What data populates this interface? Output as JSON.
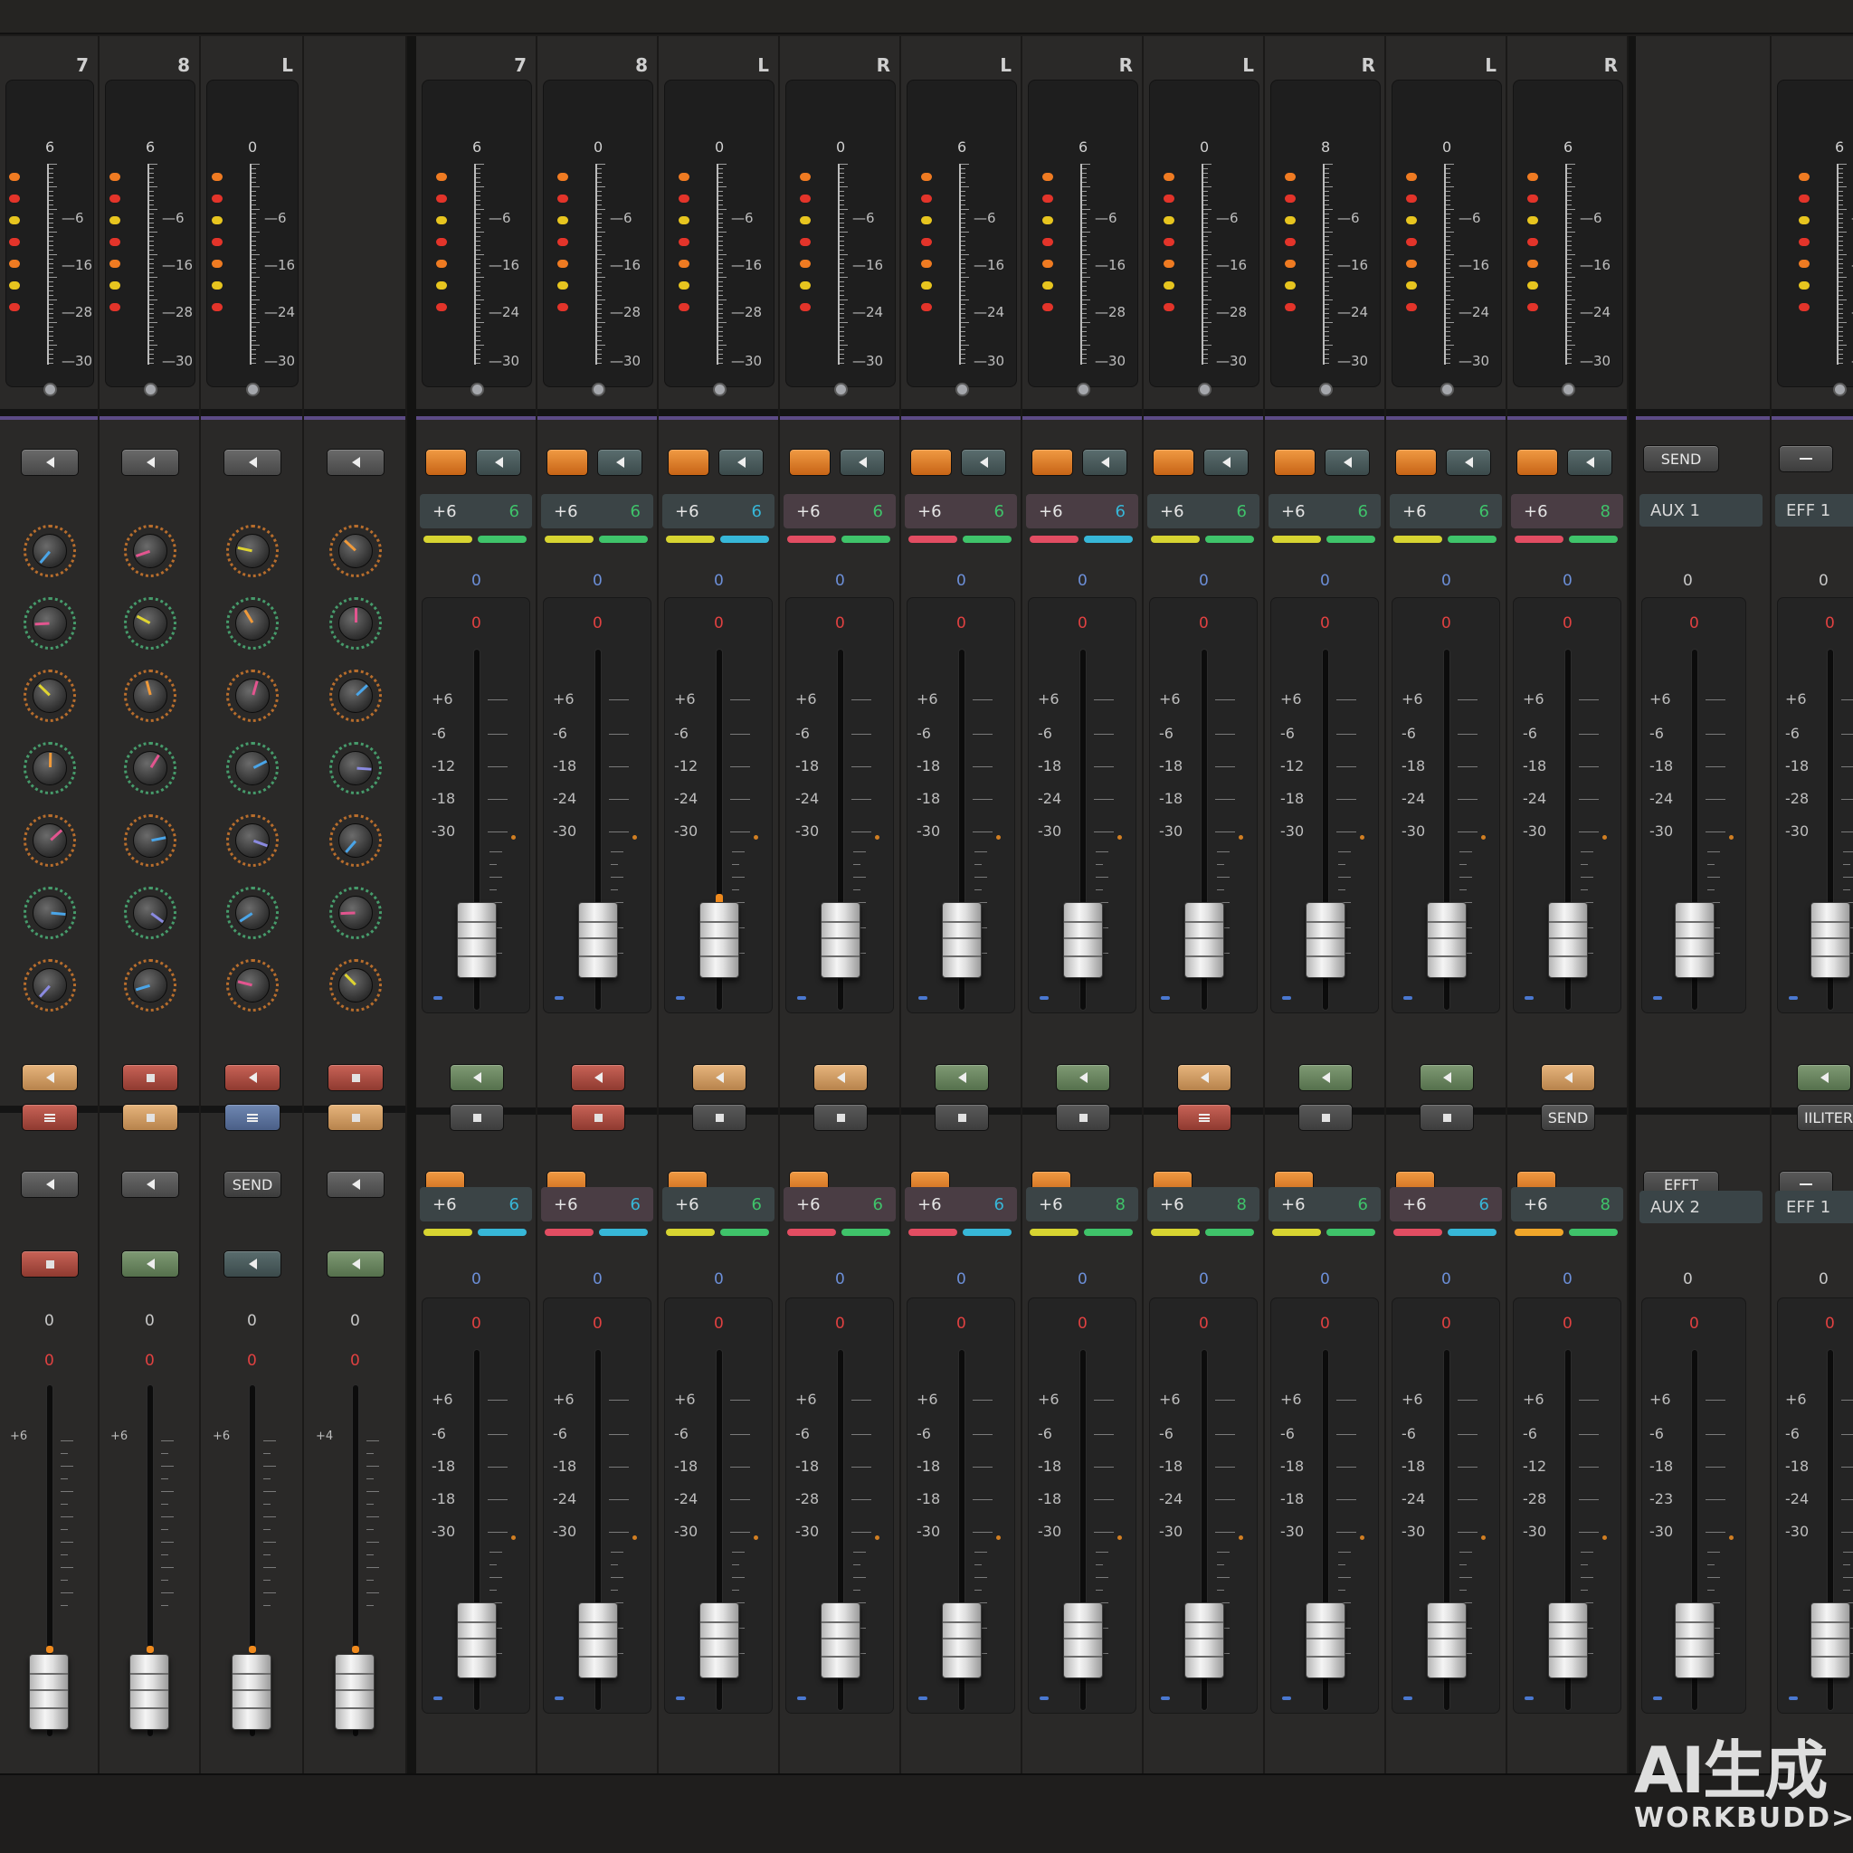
{
  "meter_scale_labels": [
    "6",
    "16",
    "28",
    "30"
  ],
  "left_strips": [
    {
      "name": "7",
      "top": "6",
      "scale": [
        "6",
        "16",
        "28",
        "30"
      ],
      "row1": {
        "color": "gray",
        "icon": "arrow"
      },
      "row_lower": [
        {
          "color": "tan",
          "icon": "arrow"
        },
        {
          "color": "red",
          "icon": "lines"
        }
      ],
      "row_b1": {
        "color": "gray",
        "icon": "arrow",
        "label": ""
      },
      "row_b2": {
        "color": "red",
        "icon": "sq"
      }
    },
    {
      "name": "8",
      "top": "6",
      "scale": [
        "6",
        "16",
        "28",
        "30"
      ],
      "row1": {
        "color": "gray",
        "icon": "arrow"
      },
      "row_lower": [
        {
          "color": "red",
          "icon": "sq"
        },
        {
          "color": "tan",
          "icon": "sq"
        }
      ],
      "row_b1": {
        "color": "gray",
        "icon": "arrow",
        "label": ""
      },
      "row_b2": {
        "color": "green",
        "icon": "arrow"
      }
    },
    {
      "name": "L",
      "top": "0",
      "scale": [
        "6",
        "16",
        "24",
        "30"
      ],
      "row1": {
        "color": "gray",
        "icon": "arrow"
      },
      "row_lower": [
        {
          "color": "red",
          "icon": "arrow"
        },
        {
          "color": "blue",
          "icon": "lines"
        }
      ],
      "row_b1": {
        "color": "dark",
        "icon": "none",
        "label": "SEND"
      },
      "row_b2": {
        "color": "teal",
        "icon": "arrow"
      }
    },
    {
      "name": "",
      "top": "",
      "scale": [],
      "row1": {
        "color": "gray",
        "icon": "arrow"
      },
      "row_lower": [
        {
          "color": "red",
          "icon": "sq"
        },
        {
          "color": "tan",
          "icon": "sq"
        }
      ],
      "row_b1": {
        "color": "gray",
        "icon": "arrow",
        "label": ""
      },
      "row_b2": {
        "color": "green",
        "icon": "arrow"
      }
    }
  ],
  "left_fader_labels": [
    "+6",
    "+6",
    "+6",
    "+4"
  ],
  "center_strips": [
    {
      "name": "7",
      "top": "6",
      "scale": [
        "6",
        "16",
        "24",
        "30"
      ],
      "pan": [
        "+6",
        "6"
      ],
      "bars": [
        "#d7d431",
        "#3fc36a"
      ],
      "fader_top": [
        "+6",
        "-6",
        "-12",
        "-18",
        "-30"
      ],
      "level": 0.03,
      "fill": "#3d7ad8",
      "btn_a": {
        "color": "green",
        "icon": "arrow",
        "label": ""
      },
      "btn_b": {
        "color": "dark",
        "icon": "sq",
        "label": ""
      },
      "pan2": [
        "+6",
        "6"
      ],
      "bars2": [
        "#d7d431",
        "#37b7d8"
      ],
      "fader_bot": [
        "+6",
        "-6",
        "-18",
        "-18",
        "-30"
      ],
      "level2": 0.03,
      "fill2": "#3d7ad8"
    },
    {
      "name": "8",
      "top": "0",
      "scale": [
        "6",
        "16",
        "28",
        "30"
      ],
      "pan": [
        "+6",
        "6"
      ],
      "bars": [
        "#d7d431",
        "#3fc36a"
      ],
      "fader_top": [
        "+6",
        "-6",
        "-18",
        "-24",
        "-30"
      ],
      "level": 0.15,
      "fill": "#f08a1d",
      "btn_a": {
        "color": "red",
        "icon": "arrow",
        "label": ""
      },
      "btn_b": {
        "color": "red",
        "icon": "sq",
        "label": ""
      },
      "pan2": [
        "+6",
        "6"
      ],
      "bars2": [
        "#e24d62",
        "#37b7d8"
      ],
      "fader_bot": [
        "+6",
        "-6",
        "-18",
        "-24",
        "-30"
      ],
      "level2": 0.03,
      "fill2": "#f08a1d"
    },
    {
      "name": "L",
      "top": "0",
      "scale": [
        "6",
        "16",
        "28",
        "30"
      ],
      "pan": [
        "+6",
        "6"
      ],
      "bars": [
        "#d7d431",
        "#37b7d8"
      ],
      "fader_top": [
        "+6",
        "-6",
        "-12",
        "-24",
        "-30"
      ],
      "level": 0.2,
      "fill": "#f08a1d",
      "btn_a": {
        "color": "tan",
        "icon": "arrow",
        "label": ""
      },
      "btn_b": {
        "color": "dark",
        "icon": "sq",
        "label": ""
      },
      "pan2": [
        "+6",
        "6"
      ],
      "bars2": [
        "#d7d431",
        "#3fc36a"
      ],
      "fader_bot": [
        "+6",
        "-6",
        "-18",
        "-24",
        "-30"
      ],
      "level2": 0.1,
      "fill2": "#f08a1d"
    },
    {
      "name": "R",
      "top": "0",
      "scale": [
        "6",
        "16",
        "24",
        "30"
      ],
      "pan": [
        "+6",
        "6"
      ],
      "bars": [
        "#e24d62",
        "#3fc36a"
      ],
      "fader_top": [
        "+6",
        "-6",
        "-18",
        "-24",
        "-30"
      ],
      "level": 0.03,
      "fill": "#3d7ad8",
      "btn_a": {
        "color": "tan",
        "icon": "arrow",
        "label": ""
      },
      "btn_b": {
        "color": "dark",
        "icon": "sq",
        "label": ""
      },
      "pan2": [
        "+6",
        "6"
      ],
      "bars2": [
        "#e24d62",
        "#3fc36a"
      ],
      "fader_bot": [
        "+6",
        "-6",
        "-18",
        "-28",
        "-30"
      ],
      "level2": 0.03,
      "fill2": "#3d7ad8"
    },
    {
      "name": "L",
      "top": "6",
      "scale": [
        "6",
        "16",
        "24",
        "30"
      ],
      "pan": [
        "+6",
        "6"
      ],
      "bars": [
        "#e24d62",
        "#3fc36a"
      ],
      "fader_top": [
        "+6",
        "-6",
        "-18",
        "-18",
        "-30"
      ],
      "level": 0.03,
      "fill": "#3d7ad8",
      "btn_a": {
        "color": "green",
        "icon": "arrow",
        "label": ""
      },
      "btn_b": {
        "color": "dark",
        "icon": "sq",
        "label": ""
      },
      "pan2": [
        "+6",
        "6"
      ],
      "bars2": [
        "#e24d62",
        "#37b7d8"
      ],
      "fader_bot": [
        "+6",
        "-6",
        "-18",
        "-18",
        "-30"
      ],
      "level2": 0.03,
      "fill2": "#f08a1d"
    },
    {
      "name": "R",
      "top": "6",
      "scale": [
        "6",
        "16",
        "28",
        "30"
      ],
      "pan": [
        "+6",
        "6"
      ],
      "bars": [
        "#e24d62",
        "#37b7d8"
      ],
      "fader_top": [
        "+6",
        "-6",
        "-18",
        "-24",
        "-30"
      ],
      "level": 0.08,
      "fill": "#f08a1d",
      "btn_a": {
        "color": "green",
        "icon": "arrow",
        "label": ""
      },
      "btn_b": {
        "color": "dark",
        "icon": "sq",
        "label": ""
      },
      "pan2": [
        "+6",
        "8"
      ],
      "bars2": [
        "#d7d431",
        "#3fc36a"
      ],
      "fader_bot": [
        "+6",
        "-6",
        "-18",
        "-18",
        "-30"
      ],
      "level2": 0.13,
      "fill2": "#f08a1d"
    },
    {
      "name": "L",
      "top": "0",
      "scale": [
        "6",
        "16",
        "28",
        "30"
      ],
      "pan": [
        "+6",
        "6"
      ],
      "bars": [
        "#d7d431",
        "#3fc36a"
      ],
      "fader_top": [
        "+6",
        "-6",
        "-18",
        "-18",
        "-30"
      ],
      "level": 0.04,
      "fill": "#f08a1d",
      "btn_a": {
        "color": "tan",
        "icon": "arrow",
        "label": ""
      },
      "btn_b": {
        "color": "red",
        "icon": "lines",
        "label": ""
      },
      "pan2": [
        "+6",
        "8"
      ],
      "bars2": [
        "#d7d431",
        "#3fc36a"
      ],
      "fader_bot": [
        "+6",
        "-6",
        "-18",
        "-24",
        "-30"
      ],
      "level2": 0.09,
      "fill2": "#d7d431"
    },
    {
      "name": "R",
      "top": "8",
      "scale": [
        "6",
        "16",
        "24",
        "30"
      ],
      "pan": [
        "+6",
        "6"
      ],
      "bars": [
        "#d7d431",
        "#3fc36a"
      ],
      "fader_top": [
        "+6",
        "-6",
        "-12",
        "-18",
        "-30"
      ],
      "level": 0.11,
      "fill": "#d7d431",
      "btn_a": {
        "color": "green",
        "icon": "arrow",
        "label": ""
      },
      "btn_b": {
        "color": "dark",
        "icon": "sq",
        "label": ""
      },
      "pan2": [
        "+6",
        "6"
      ],
      "bars2": [
        "#d7d431",
        "#3fc36a"
      ],
      "fader_bot": [
        "+6",
        "-6",
        "-18",
        "-18",
        "-30"
      ],
      "level2": 0.03,
      "fill2": "#3d7ad8"
    },
    {
      "name": "L",
      "top": "0",
      "scale": [
        "6",
        "16",
        "24",
        "30"
      ],
      "pan": [
        "+6",
        "6"
      ],
      "bars": [
        "#d7d431",
        "#3fc36a"
      ],
      "fader_top": [
        "+6",
        "-6",
        "-18",
        "-24",
        "-30"
      ],
      "level": 0.05,
      "fill": "#d7d431",
      "btn_a": {
        "color": "green",
        "icon": "arrow",
        "label": ""
      },
      "btn_b": {
        "color": "dark",
        "icon": "sq",
        "label": ""
      },
      "pan2": [
        "+6",
        "6"
      ],
      "bars2": [
        "#e24d62",
        "#37b7d8"
      ],
      "fader_bot": [
        "+6",
        "-6",
        "-18",
        "-24",
        "-30"
      ],
      "level2": 0.03,
      "fill2": "#f08a1d"
    },
    {
      "name": "R",
      "top": "6",
      "scale": [
        "6",
        "16",
        "24",
        "30"
      ],
      "pan": [
        "+6",
        "8"
      ],
      "bars": [
        "#e24d62",
        "#3fc36a"
      ],
      "fader_top": [
        "+6",
        "-6",
        "-18",
        "-24",
        "-30"
      ],
      "level": 0.11,
      "fill": "#d7d431",
      "btn_a": {
        "color": "tan",
        "icon": "arrow",
        "label": ""
      },
      "btn_b": {
        "color": "dark",
        "icon": "none",
        "label": "SEND"
      },
      "pan2": [
        "+6",
        "8"
      ],
      "bars2": [
        "#f0a62a",
        "#3fc36a"
      ],
      "fader_bot": [
        "+6",
        "-6",
        "-12",
        "-28",
        "-30"
      ],
      "level2": 0.03,
      "fill2": "#3d7ad8"
    }
  ],
  "right_strips": [
    {
      "send_btn": "SEND",
      "box1": "AUX 1",
      "box2": "AUX 2",
      "btn2": "EFFT",
      "fader_top": [
        "+6",
        "-6",
        "-18",
        "-24",
        "-30"
      ],
      "fader_bot": [
        "+6",
        "-6",
        "-18",
        "-23",
        "-30"
      ],
      "level": 0.03,
      "fill": "#f08a1d",
      "level2": 0.03,
      "fill2": "#f08a1d"
    },
    {
      "send_btn": "",
      "box1": "EFF 1",
      "box2": "EFF 1",
      "btn2": "",
      "fader_top": [
        "+6",
        "-6",
        "-18",
        "-28",
        "-30"
      ],
      "fader_bot": [
        "+6",
        "-6",
        "-18",
        "-24",
        "-30"
      ],
      "level": 0.03,
      "fill": "#3d7ad8",
      "level2": 0.08,
      "fill2": "#f08a1d",
      "extra_btn": "IILITER"
    }
  ],
  "zero_label": "0",
  "watermark": {
    "line1": "AI生成",
    "line2": "WORKBUDD>_"
  }
}
